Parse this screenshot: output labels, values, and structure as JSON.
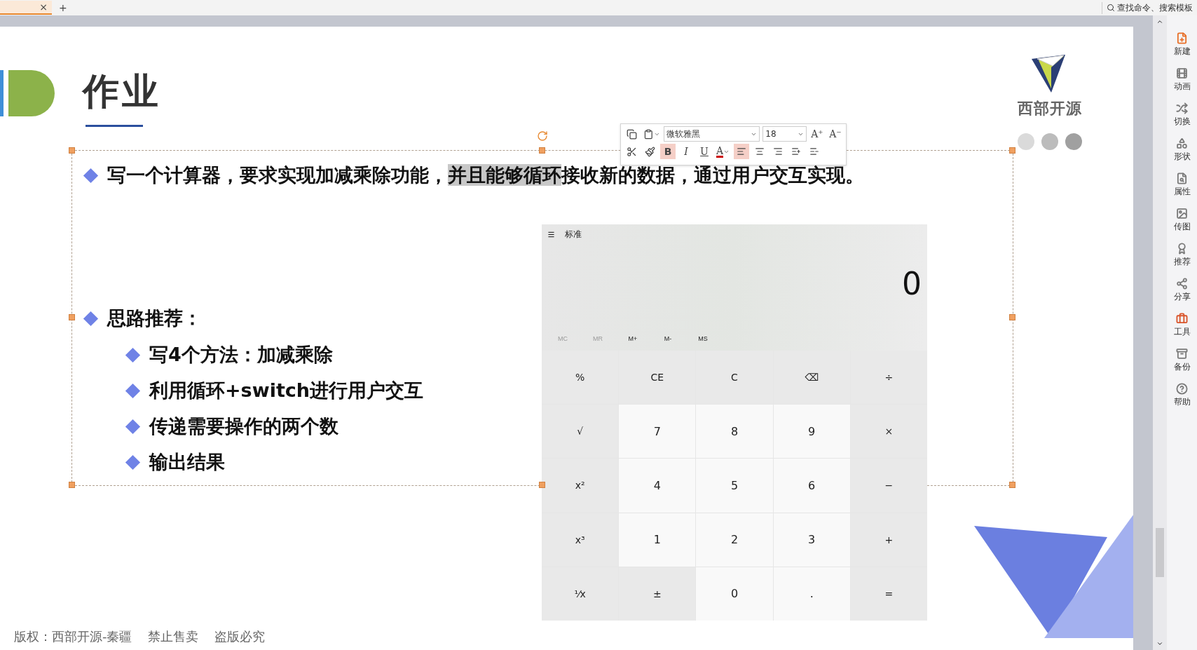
{
  "top_bar": {
    "tab_close": "×",
    "new_tab": "+",
    "search": {
      "placeholder": "查找命令、搜索模板"
    }
  },
  "slide": {
    "title": "作业",
    "task": {
      "before": "写一个计算器，要求实现加减乘除功能，",
      "highlighted": "并且能够循环",
      "after": "接收新的数据，通过用户交互实现。"
    },
    "ideas": {
      "heading": "思路推荐：",
      "children": [
        {
          "text": "写4个方法：加减乘除"
        },
        {
          "text": "利用循环+switch进行用户交互"
        },
        {
          "text": "传递需要操作的两个数"
        },
        {
          "text": "输出结果"
        }
      ]
    },
    "logo_text": "西部开源",
    "copyright": "版权：西部开源-秦疆    禁止售卖    盗版必究",
    "calculator": {
      "mode": "标准",
      "display": "0",
      "memory": [
        {
          "label": "MC",
          "disabled": true
        },
        {
          "label": "MR",
          "disabled": true
        },
        {
          "label": "M+",
          "disabled": false
        },
        {
          "label": "M-",
          "disabled": false
        },
        {
          "label": "MS",
          "disabled": false
        }
      ],
      "keys": [
        {
          "label": "%",
          "kind": "function"
        },
        {
          "label": "CE",
          "kind": "function"
        },
        {
          "label": "C",
          "kind": "function"
        },
        {
          "label": "⌫",
          "kind": "function"
        },
        {
          "label": "÷",
          "kind": "function"
        },
        {
          "label": "√",
          "kind": "function"
        },
        {
          "label": "7",
          "kind": "digit"
        },
        {
          "label": "8",
          "kind": "digit"
        },
        {
          "label": "9",
          "kind": "digit"
        },
        {
          "label": "×",
          "kind": "function"
        },
        {
          "label": "x²",
          "kind": "function"
        },
        {
          "label": "4",
          "kind": "digit"
        },
        {
          "label": "5",
          "kind": "digit"
        },
        {
          "label": "6",
          "kind": "digit"
        },
        {
          "label": "−",
          "kind": "function"
        },
        {
          "label": "x³",
          "kind": "function"
        },
        {
          "label": "1",
          "kind": "digit"
        },
        {
          "label": "2",
          "kind": "digit"
        },
        {
          "label": "3",
          "kind": "digit"
        },
        {
          "label": "+",
          "kind": "function"
        },
        {
          "label": "⅟x",
          "kind": "function"
        },
        {
          "label": "±",
          "kind": "function"
        },
        {
          "label": "0",
          "kind": "digit"
        },
        {
          "label": ".",
          "kind": "digit"
        },
        {
          "label": "=",
          "kind": "function"
        }
      ]
    }
  },
  "format_toolbar": {
    "font": "微软雅黑",
    "size": "18",
    "grow": "A⁺",
    "shrink": "A⁻",
    "buttons": [
      {
        "kind": "bold",
        "label": "B",
        "selected": true
      },
      {
        "kind": "italic",
        "label": "I",
        "selected": false
      },
      {
        "kind": "underline",
        "label": "U",
        "selected": false
      },
      {
        "kind": "color",
        "label": "A",
        "selected": false
      },
      {
        "kind": "align-left",
        "selected": true
      },
      {
        "kind": "align-center",
        "selected": false
      },
      {
        "kind": "align-right",
        "selected": false
      },
      {
        "kind": "spacing-up",
        "selected": false
      },
      {
        "kind": "spacing-down",
        "selected": false
      }
    ]
  },
  "sidebar": {
    "items": [
      {
        "label": "新建",
        "color": "#e8702a"
      },
      {
        "label": "动画",
        "color": "#7a7a7a"
      },
      {
        "label": "切换",
        "color": "#7a7a7a"
      },
      {
        "label": "形状",
        "color": "#7a7a7a"
      },
      {
        "label": "属性",
        "color": "#7a7a7a"
      },
      {
        "label": "传图",
        "color": "#7a7a7a"
      },
      {
        "label": "推荐",
        "color": "#7a7a7a"
      },
      {
        "label": "分享",
        "color": "#7a7a7a"
      },
      {
        "label": "工具",
        "color": "#d9552b"
      },
      {
        "label": "备份",
        "color": "#7a7a7a"
      },
      {
        "label": "帮助",
        "color": "#7a7a7a"
      }
    ]
  }
}
